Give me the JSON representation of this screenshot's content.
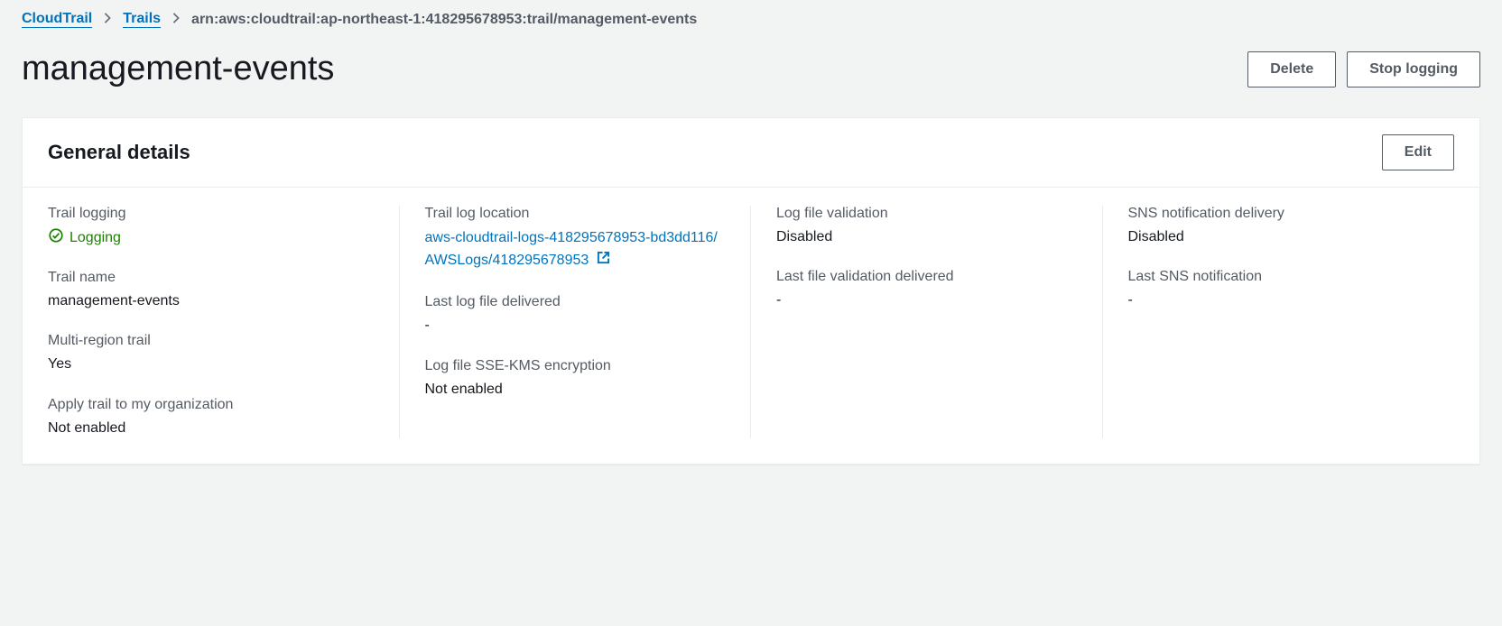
{
  "breadcrumbs": {
    "root": "CloudTrail",
    "section": "Trails",
    "current": "arn:aws:cloudtrail:ap-northeast-1:418295678953:trail/management-events"
  },
  "header": {
    "title": "management-events",
    "delete_label": "Delete",
    "stop_logging_label": "Stop logging"
  },
  "general_details": {
    "title": "General details",
    "edit_label": "Edit",
    "col1": {
      "trail_logging_label": "Trail logging",
      "trail_logging_status": "Logging",
      "trail_name_label": "Trail name",
      "trail_name_value": "management-events",
      "multi_region_label": "Multi-region trail",
      "multi_region_value": "Yes",
      "apply_org_label": "Apply trail to my organization",
      "apply_org_value": "Not enabled"
    },
    "col2": {
      "log_location_label": "Trail log location",
      "log_location_value": "aws-cloudtrail-logs-418295678953-bd3dd116/AWSLogs/418295678953",
      "last_log_delivered_label": "Last log file delivered",
      "last_log_delivered_value": "-",
      "sse_kms_label": "Log file SSE-KMS encryption",
      "sse_kms_value": "Not enabled"
    },
    "col3": {
      "validation_label": "Log file validation",
      "validation_value": "Disabled",
      "last_validation_label": "Last file validation delivered",
      "last_validation_value": "-"
    },
    "col4": {
      "sns_label": "SNS notification delivery",
      "sns_value": "Disabled",
      "last_sns_label": "Last SNS notification",
      "last_sns_value": "-"
    }
  }
}
